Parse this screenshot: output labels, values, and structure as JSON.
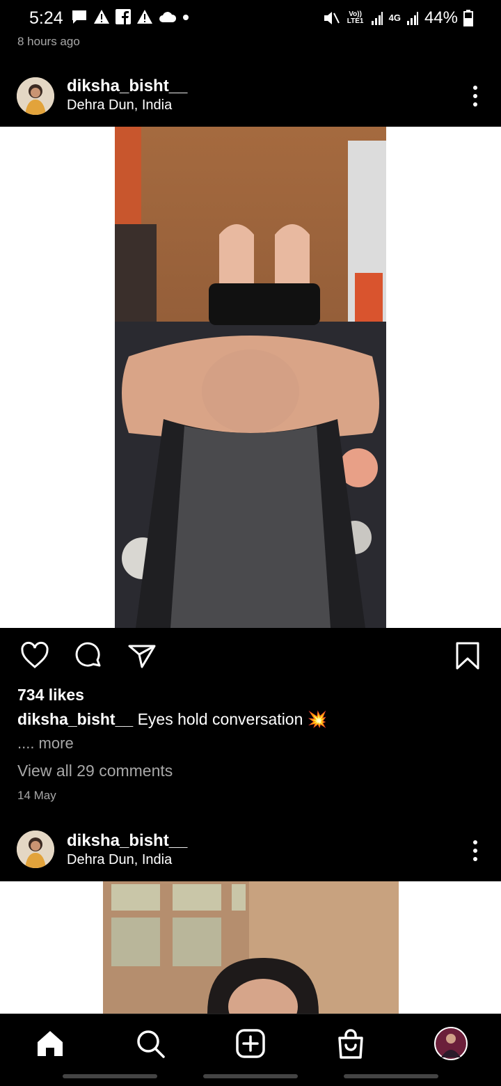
{
  "status_bar": {
    "time": "5:24",
    "volte": "Vo)) LTE1",
    "network": "4G",
    "battery": "44%",
    "notification_icons": [
      "message-icon",
      "alert-icon",
      "facebook-icon",
      "alert-icon",
      "cloud-icon",
      "dot-icon"
    ]
  },
  "previous_post": {
    "time_ago": "8 hours ago"
  },
  "post1": {
    "username": "diksha_bisht__",
    "location": "Dehra Dun, India",
    "likes": "734 likes",
    "caption_user": "diksha_bisht__",
    "caption_text": " Eyes hold conversation 💥",
    "more": ".... more",
    "view_comments": "View all 29 comments",
    "date": "14 May"
  },
  "post2": {
    "username": "diksha_bisht__",
    "location": "Dehra Dun, India"
  },
  "nav": [
    "home-icon",
    "search-icon",
    "create-icon",
    "shop-icon",
    "profile-avatar"
  ],
  "colors": {
    "background": "#000000",
    "secondary_text": "#a8a8a8",
    "media_bg": "#ffffff"
  }
}
